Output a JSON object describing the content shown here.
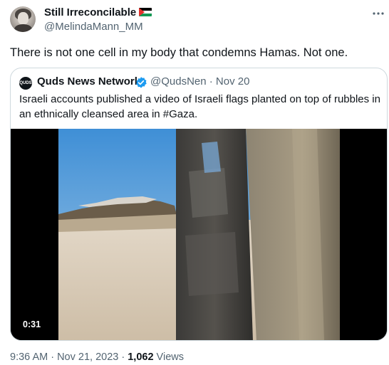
{
  "author": {
    "display_name": "Still Irreconcilable",
    "handle": "@MelindaMann_MM",
    "flag_icon": "palestine-flag-icon"
  },
  "tweet": {
    "text": "There is not one cell in my body that condemns Hamas. Not one."
  },
  "quoted": {
    "avatar_text": "QUDS",
    "display_name": "Quds News Network",
    "handle_and_date": "@QudsNen · Nov 20",
    "text": "Israeli accounts published a video of Israeli flags planted on top of rubbles in an ethnically cleansed area in #Gaza.",
    "video_duration": "0:31"
  },
  "meta": {
    "timestamp": "9:36 AM · Nov 21, 2023 · ",
    "views_count": "1,062",
    "views_label": " Views"
  },
  "colors": {
    "text_primary": "#0f1419",
    "text_secondary": "#536471",
    "border": "#cfd9de",
    "verified": "#1d9bf0"
  }
}
